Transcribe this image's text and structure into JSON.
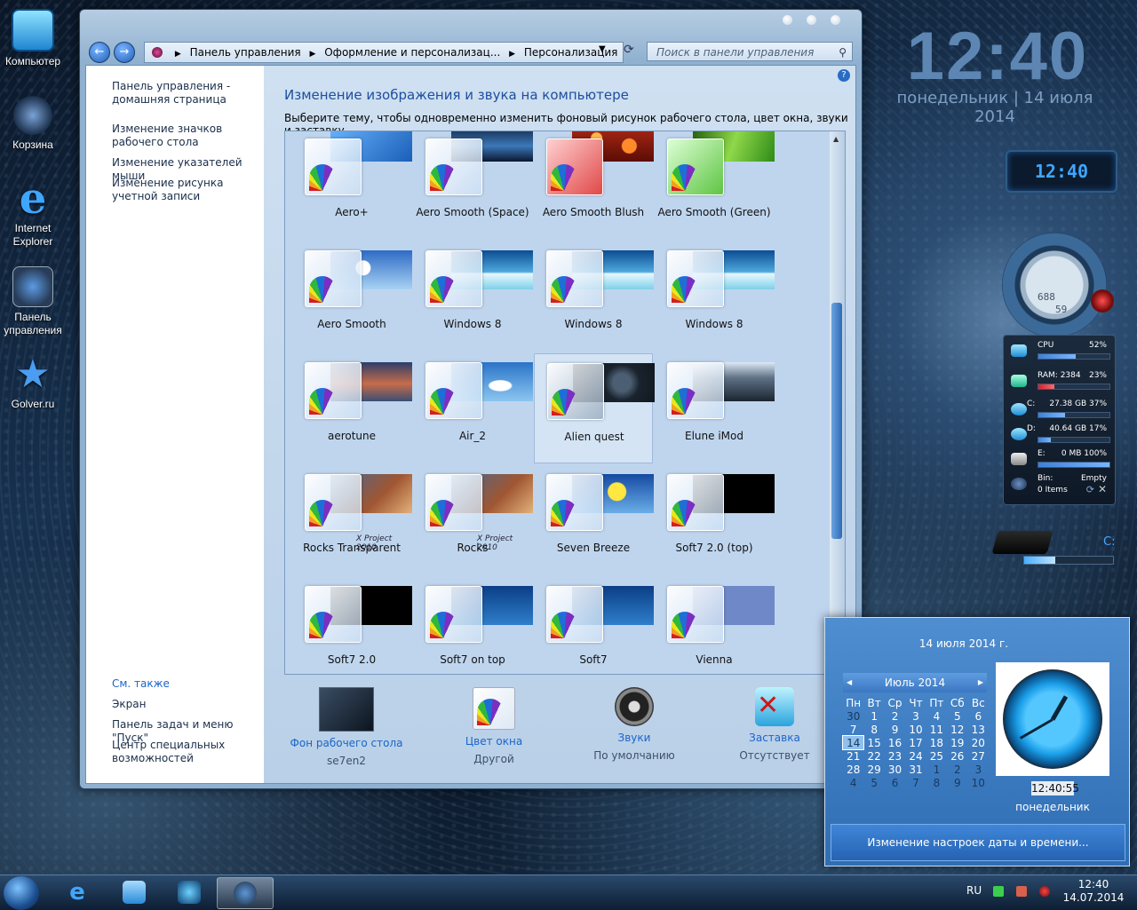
{
  "desktop": {
    "icons": [
      {
        "label": "Компьютер"
      },
      {
        "label": "Корзина"
      },
      {
        "label": "Internet Explorer"
      },
      {
        "label": "Панель управления"
      },
      {
        "label": "Golver.ru"
      }
    ]
  },
  "window": {
    "address": {
      "segments": [
        "Панель управления",
        "Оформление и персонализац...",
        "Персонализация"
      ]
    },
    "search_placeholder": "Поиск в панели управления",
    "help_label": "?",
    "sidebar": {
      "links": [
        "Панель управления - домашняя страница",
        "Изменение значков рабочего стола",
        "Изменение указателей мыши",
        "Изменение рисунка учетной записи"
      ],
      "see_also_title": "См. также",
      "see_also": [
        "Экран",
        "Панель задач и меню \"Пуск\"",
        "Центр специальных возможностей"
      ]
    },
    "heading": "Изменение изображения и звука на компьютере",
    "subheading": "Выберите тему, чтобы одновременно изменить фоновый рисунок рабочего стола, цвет окна, звуки и заставку.",
    "themes": [
      {
        "name": "Aero+"
      },
      {
        "name": "Aero Smooth (Space)"
      },
      {
        "name": "Aero Smooth Blush"
      },
      {
        "name": "Aero Smooth (Green)"
      },
      {
        "name": "Aero Smooth"
      },
      {
        "name": "Windows 8"
      },
      {
        "name": "Windows 8"
      },
      {
        "name": "Windows 8"
      },
      {
        "name": "aerotune"
      },
      {
        "name": "Air_2"
      },
      {
        "name": "Alien quest",
        "selected": true
      },
      {
        "name": "Elune iMod"
      },
      {
        "name": "Rocks Transparent",
        "watermark": "X Project 2010"
      },
      {
        "name": "Rocks",
        "watermark": "X Project 2010"
      },
      {
        "name": "Seven Breeze"
      },
      {
        "name": "Soft7 2.0 (top)"
      },
      {
        "name": "Soft7 2.0"
      },
      {
        "name": "Soft7 on top"
      },
      {
        "name": "Soft7"
      },
      {
        "name": "Vienna"
      }
    ],
    "bottom": [
      {
        "title": "Фон рабочего стола",
        "value": "se7en2"
      },
      {
        "title": "Цвет окна",
        "value": "Другой"
      },
      {
        "title": "Звуки",
        "value": "По умолчанию"
      },
      {
        "title": "Заставка",
        "value": "Отсутствует"
      }
    ]
  },
  "gadgets": {
    "big_clock": "12:40",
    "big_date": "понедельник | 14 июля 2014",
    "small_clock": "12:40",
    "gauge": {
      "top": "688",
      "bottom": "59"
    },
    "sysmon": [
      {
        "name": "CPU",
        "value": "52%",
        "fill": 0.52
      },
      {
        "name": "RAM: 2384",
        "value": "23%",
        "fill": 0.23
      },
      {
        "name": "C:",
        "value": "27.38 GB 37%",
        "fill": 0.37
      },
      {
        "name": "D:",
        "value": "40.64 GB 17%",
        "fill": 0.17
      },
      {
        "name": "E:",
        "value": "0 MB 100%",
        "fill": 1.0
      }
    ],
    "bin": {
      "label": "Bin:",
      "state": "Empty",
      "items": "0 Items"
    },
    "drive_label": "C:",
    "drive_fill": 0.35
  },
  "calendar": {
    "date": "14 июля 2014 г.",
    "month": "Июль 2014",
    "weekdays": [
      "Пн",
      "Вт",
      "Ср",
      "Чт",
      "Пт",
      "Сб",
      "Вс"
    ],
    "weeks": [
      [
        "30",
        "1",
        "2",
        "3",
        "4",
        "5",
        "6"
      ],
      [
        "7",
        "8",
        "9",
        "10",
        "11",
        "12",
        "13"
      ],
      [
        "14",
        "15",
        "16",
        "17",
        "18",
        "19",
        "20"
      ],
      [
        "21",
        "22",
        "23",
        "24",
        "25",
        "26",
        "27"
      ],
      [
        "28",
        "29",
        "30",
        "31",
        "1",
        "2",
        "3"
      ],
      [
        "4",
        "5",
        "6",
        "7",
        "8",
        "9",
        "10"
      ]
    ],
    "today": "14",
    "time": "12:40:55",
    "weekday_name": "понедельник",
    "change_link": "Изменение настроек даты и времени..."
  },
  "taskbar": {
    "lang": "RU",
    "time": "12:40",
    "date": "14.07.2014"
  }
}
